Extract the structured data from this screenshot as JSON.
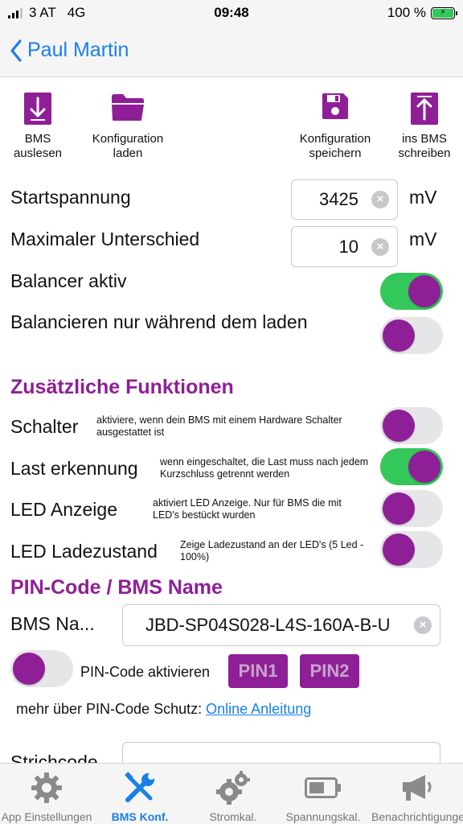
{
  "status_bar": {
    "carrier": "3 AT",
    "network": "4G",
    "time": "09:48",
    "battery": "100 %"
  },
  "nav": {
    "back_label": "Paul Martin"
  },
  "toolbar": {
    "bms_read": "BMS\nauslesen",
    "config_load": "Konfiguration\nladen",
    "config_save": "Konfiguration\nspeichern",
    "bms_write": "ins BMS\nschreiben"
  },
  "settings": {
    "start_voltage": {
      "label": "Startspannung",
      "value": "3425",
      "unit": "mV"
    },
    "max_difference": {
      "label": "Maximaler Unterschied",
      "value": "10",
      "unit": "mV"
    },
    "balancer_active": {
      "label": "Balancer aktiv",
      "on": true
    },
    "balance_charging": {
      "label": "Balancieren nur während dem laden",
      "on": false
    }
  },
  "extra": {
    "title": "Zusätzliche Funktionen",
    "switch": {
      "label": "Schalter",
      "hint": "aktiviere, wenn dein BMS mit einem Hardware Schalter ausgestattet ist",
      "on": false
    },
    "load_detect": {
      "label": "Last erkennung",
      "hint": "wenn eingeschaltet, die Last muss nach jedem Kurzschluss getrennt werden",
      "on": true
    },
    "led_display": {
      "label": "LED Anzeige",
      "hint": "aktiviert LED Anzeige. Nur für BMS die mit LED's bestückt wurden",
      "on": false
    },
    "led_charge": {
      "label": "LED Ladezustand",
      "hint": "Zeige Ladezustand an der LED's (5 Led - 100%)",
      "on": false
    }
  },
  "pin": {
    "title": "PIN-Code / BMS Name",
    "bms_name_label": "BMS Na...",
    "bms_name_value": "JBD-SP04S028-L4S-160A-B-U",
    "activate_label": "PIN-Code aktivieren",
    "activate_on": false,
    "pin1": "PIN1",
    "pin2": "PIN2",
    "more_text": "mehr über PIN-Code Schutz:",
    "more_link": "Online Anleitung",
    "barcode_label": "Strichcode"
  },
  "tabs": [
    {
      "label": "App Einstellungen",
      "icon": "gear-icon"
    },
    {
      "label": "BMS Konf.",
      "icon": "tools-icon",
      "active": true
    },
    {
      "label": "Stromkal.",
      "icon": "gears-icon"
    },
    {
      "label": "Spannungskal.",
      "icon": "battery-icon"
    },
    {
      "label": "Benachrichtigungen",
      "icon": "megaphone-icon"
    }
  ],
  "colors": {
    "accent": "#8e1f96",
    "link": "#1a80e6",
    "switch_on": "#34c759"
  }
}
